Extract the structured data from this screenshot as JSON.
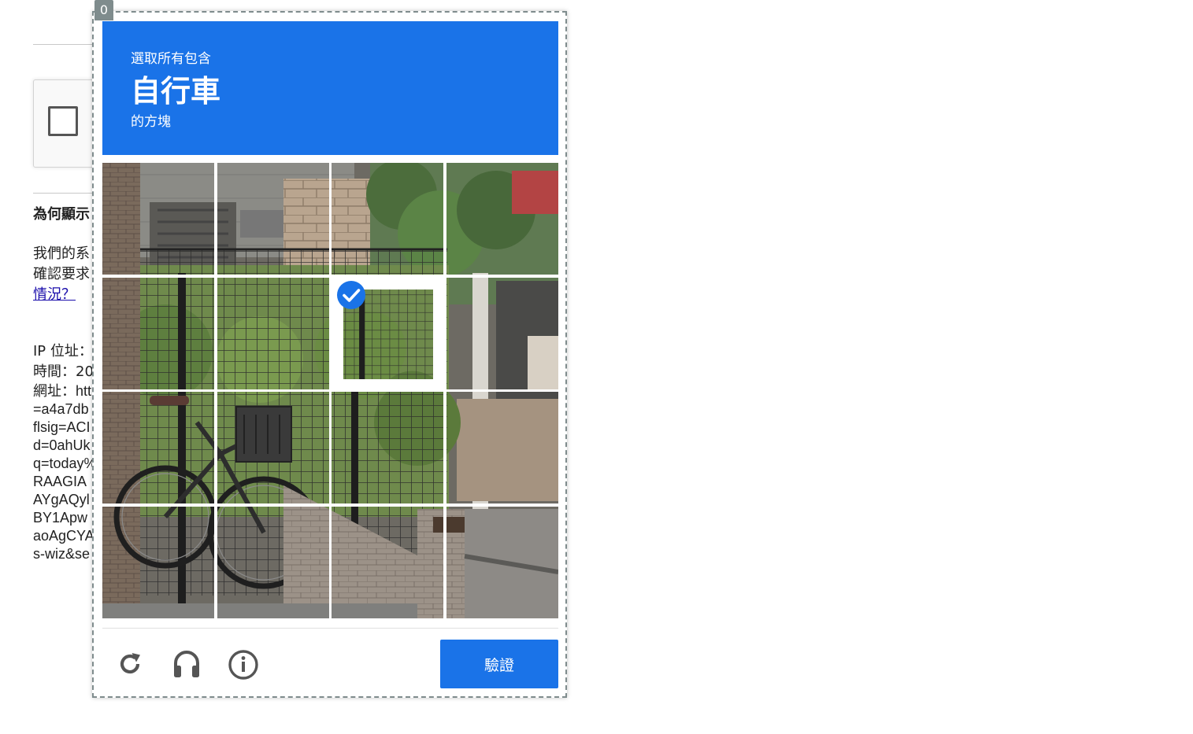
{
  "background_page": {
    "heading": "為何顯示",
    "paragraph_lines": [
      "我們的系",
      "確認要求"
    ],
    "link_text": "情況？",
    "ip_label": "IP 位址：",
    "time_label": "時間：20",
    "url_lines": [
      "網址：htt",
      "=a4a7db",
      "flsig=ACI",
      "d=0ahUk",
      "q=today%",
      "RAAGIA",
      "AYgAQyl",
      "BY1Apw",
      "aoAgCYA",
      "s-wiz&se"
    ]
  },
  "popup": {
    "index_badge": "0",
    "header": {
      "prefix": "選取所有包含",
      "target": "自行車",
      "suffix": "的方塊",
      "color": "#1a73e8"
    },
    "grid": {
      "rows": 4,
      "cols": 4,
      "selected_tiles": [
        [
          1,
          2
        ]
      ],
      "tile_labels": [
        [
          "tile-r1-c1",
          "tile-r1-c2",
          "tile-r1-c3",
          "tile-r1-c4"
        ],
        [
          "tile-r2-c1",
          "tile-r2-c2",
          "tile-r2-c3",
          "tile-r2-c4"
        ],
        [
          "tile-r3-c1",
          "tile-r3-c2",
          "tile-r3-c3",
          "tile-r3-c4"
        ],
        [
          "tile-r4-c1",
          "tile-r4-c2",
          "tile-r4-c3",
          "tile-r4-c4"
        ]
      ]
    },
    "footer": {
      "icons": [
        "reload-icon",
        "audio-headphones-icon",
        "info-icon"
      ],
      "verify_label": "驗證",
      "verify_color": "#1a73e8"
    }
  }
}
